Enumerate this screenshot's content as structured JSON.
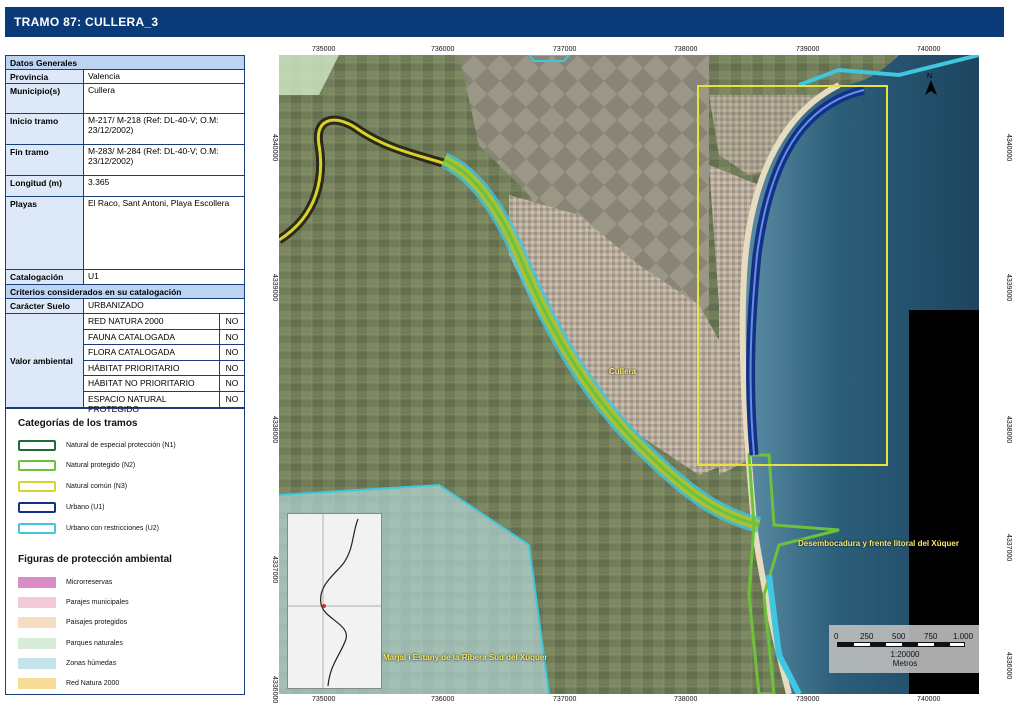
{
  "header": {
    "title": "TRAMO 87: CULLERA_3"
  },
  "datos_generales": {
    "section_title": "Datos Generales",
    "rows": [
      {
        "label": "Provincia",
        "value": "Valencia"
      },
      {
        "label": "Municipio(s)",
        "value": "Cullera"
      },
      {
        "label": "Inicio tramo",
        "value": "M-217/ M-218 (Ref: DL-40-V; O.M: 23/12/2002)"
      },
      {
        "label": "Fin tramo",
        "value": "M-283/ M-284 (Ref: DL-40-V; O.M: 23/12/2002)"
      },
      {
        "label": "Longitud (m)",
        "value": "3.365"
      },
      {
        "label": "Playas",
        "value": "El Raco, Sant Antoni, Playa Escollera"
      },
      {
        "label": "Catalogación",
        "value": "U1"
      }
    ]
  },
  "criterios": {
    "section_title": "Criterios considerados en su catalogación",
    "caracter_label": "Carácter Suelo",
    "caracter_value": "URBANIZADO",
    "valor_label": "Valor ambiental",
    "items": [
      {
        "name": "RED NATURA 2000",
        "value": "NO"
      },
      {
        "name": "FAUNA CATALOGADA",
        "value": "NO"
      },
      {
        "name": "FLORA CATALOGADA",
        "value": "NO"
      },
      {
        "name": "HÁBITAT PRIORITARIO",
        "value": "NO"
      },
      {
        "name": "HÁBITAT NO PRIORITARIO",
        "value": "NO"
      },
      {
        "name": "ESPACIO NATURAL PROTEGIDO",
        "value": "NO"
      }
    ]
  },
  "legend": {
    "categorias_title": "Categorías de los tramos",
    "categorias": [
      {
        "label": "Natural de especial protección (N1)",
        "color": "#1e6b3a"
      },
      {
        "label": "Natural protegido (N2)",
        "color": "#6cc23a"
      },
      {
        "label": "Natural común (N3)",
        "color": "#d9d12e"
      },
      {
        "label": "Urbano (U1)",
        "color": "#12328a"
      },
      {
        "label": "Urbano con restricciones (U2)",
        "color": "#3fc7e0"
      }
    ],
    "figuras_title": "Figuras de protección ambiental",
    "figuras": [
      {
        "label": "Microrreservas",
        "color": "#d98cc6"
      },
      {
        "label": "Parajes municipales",
        "color": "#f3cbd6"
      },
      {
        "label": "Paisajes protegidos",
        "color": "#f6dcc0"
      },
      {
        "label": "Parques naturales",
        "color": "#d7ecd9"
      },
      {
        "label": "Zonas húmedas",
        "color": "#c5e3ea"
      },
      {
        "label": "Red Natura 2000",
        "color": "#f6dc97"
      }
    ]
  },
  "map": {
    "x_ticks": [
      "735000",
      "736000",
      "737000",
      "738000",
      "739000",
      "740000"
    ],
    "y_ticks": [
      "4340000",
      "4339000",
      "4338000",
      "4337000",
      "4336000"
    ],
    "labels": {
      "cullera": "Cullera",
      "desembocadura": "Desembocadura y frente litoral del Xúquer",
      "marjal": "Marjal i Estany de la Ribera Sud del Xúquer"
    },
    "north_label": "N",
    "scale": {
      "ticks": [
        "0",
        "250",
        "500",
        "750",
        "1.000"
      ],
      "ratio": "1:20000",
      "units": "Metros"
    }
  }
}
